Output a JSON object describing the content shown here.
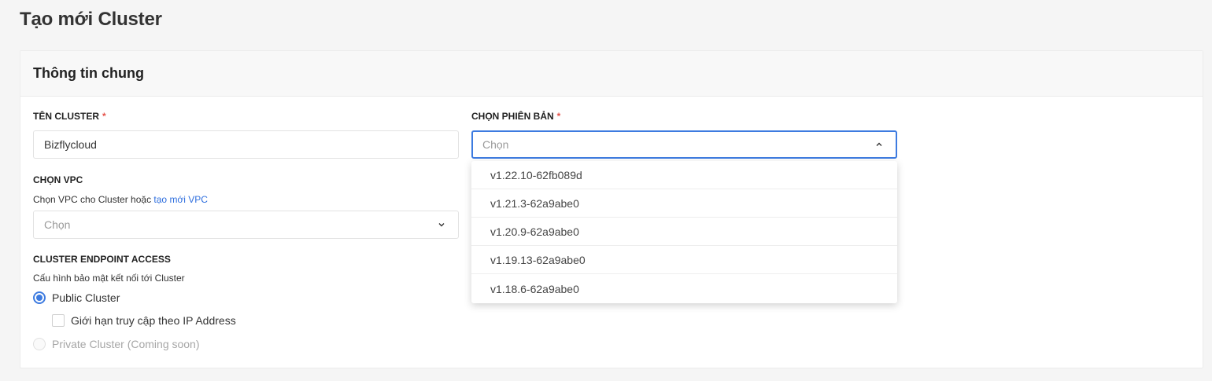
{
  "page": {
    "title": "Tạo mới Cluster"
  },
  "card": {
    "title": "Thông tin chung"
  },
  "cluster_name": {
    "label": "TÊN CLUSTER",
    "required_mark": "*",
    "value": "Bizflycloud"
  },
  "version": {
    "label": "CHỌN PHIÊN BẢN",
    "required_mark": "*",
    "placeholder": "Chọn",
    "options": [
      "v1.22.10-62fb089d",
      "v1.21.3-62a9abe0",
      "v1.20.9-62a9abe0",
      "v1.19.13-62a9abe0",
      "v1.18.6-62a9abe0"
    ]
  },
  "vpc": {
    "label": "CHỌN VPC",
    "help_text": "Chọn VPC cho Cluster hoặc ",
    "help_link": "tạo mới VPC",
    "placeholder": "Chọn"
  },
  "endpoint": {
    "label": "CLUSTER ENDPOINT ACCESS",
    "help_text": "Cấu hình bảo mật kết nối tới Cluster",
    "public_label": "Public Cluster",
    "ip_limit_label": "Giới hạn truy cập theo IP Address",
    "private_label": "Private Cluster (Coming soon)"
  },
  "colors": {
    "accent": "#3d7be0",
    "required": "#e5534b",
    "link": "#2f6fde"
  }
}
